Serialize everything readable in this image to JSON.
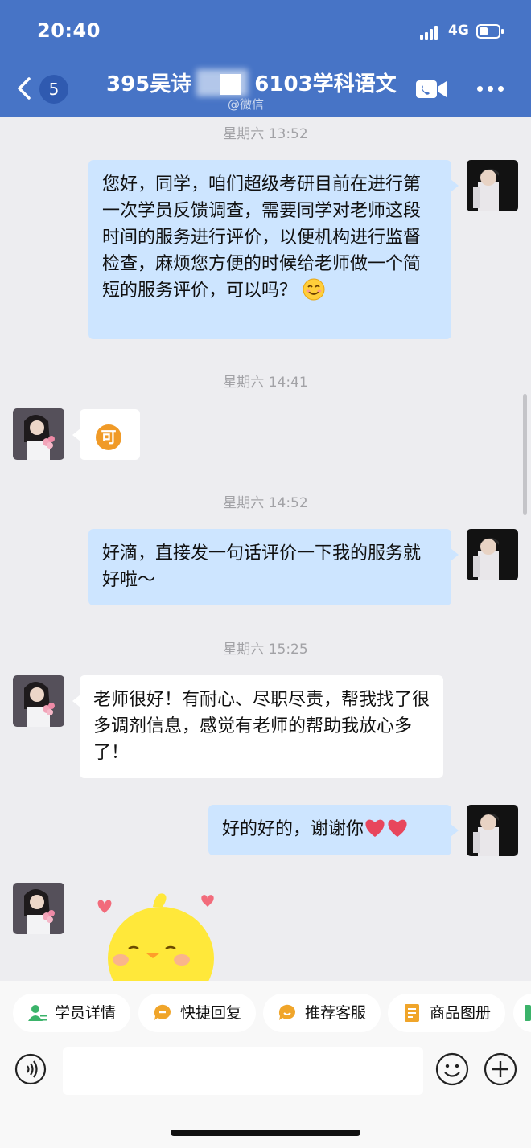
{
  "status": {
    "time": "20:40",
    "network": "4G",
    "battery_level": 0.45
  },
  "header": {
    "back_badge": "5",
    "title": "395吴诗　　　6103学科语文",
    "subtitle": "@微信"
  },
  "messages": [
    {
      "kind": "time",
      "text": "星期六 13:52"
    },
    {
      "kind": "me",
      "text": "您好，同学，咱们超级考研目前在进行第一次学员反馈调查，需要同学对老师这段时间的服务进行评价，以便机构进行监督检查，麻烦您方便的时候给老师做一个简短的服务评价，可以吗？",
      "emoji": "smiling-face"
    },
    {
      "kind": "time",
      "text": "星期六 14:41"
    },
    {
      "kind": "them",
      "text": "可",
      "style": "orange-circle-emoji"
    },
    {
      "kind": "time",
      "text": "星期六 14:52"
    },
    {
      "kind": "me",
      "text": "好滴，直接发一句话评价一下我的服务就好啦～"
    },
    {
      "kind": "time",
      "text": "星期六 15:25"
    },
    {
      "kind": "them",
      "text": "老师很好！有耐心、尽职尽责，帮我找了很多调剂信息，感觉有老师的帮助我放心多了！"
    },
    {
      "kind": "me",
      "text": "好的好的，谢谢你",
      "emoji": "two-red-hearts"
    },
    {
      "kind": "them-sticker",
      "sticker": "yellow-chick-hearts"
    }
  ],
  "quick_actions": [
    {
      "label": "学员详情",
      "icon": "person-icon",
      "color": "#3bb36a"
    },
    {
      "label": "快捷回复",
      "icon": "chat-bubble-icon",
      "color": "#f0a52a"
    },
    {
      "label": "推荐客服",
      "icon": "service-icon",
      "color": "#f0a52a"
    },
    {
      "label": "商品图册",
      "icon": "document-icon",
      "color": "#f0a52a"
    }
  ],
  "input": {
    "placeholder": ""
  },
  "colors": {
    "header": "#4774c6",
    "my_bubble": "#cde5ff",
    "their_bubble": "#ffffff",
    "background": "#ededf0"
  }
}
